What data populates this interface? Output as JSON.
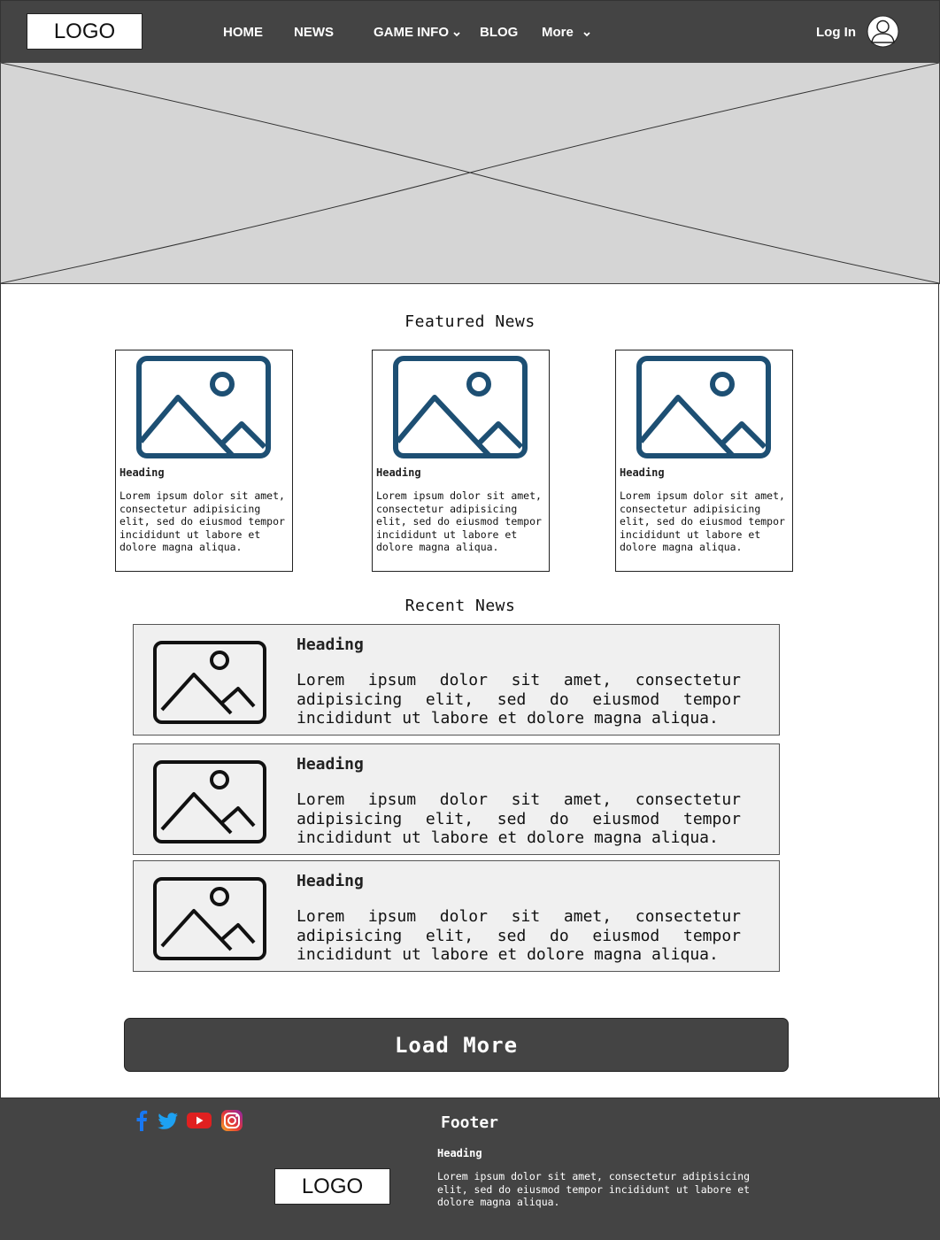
{
  "header": {
    "logo": "LOGO",
    "nav": [
      {
        "label": "HOME",
        "has_dropdown": false
      },
      {
        "label": "NEWS",
        "has_dropdown": false
      },
      {
        "label": "GAME INFO",
        "has_dropdown": true
      },
      {
        "label": "BLOG",
        "has_dropdown": false
      },
      {
        "label": "More",
        "has_dropdown": true
      }
    ],
    "login": "Log In",
    "avatar_icon": "user-avatar-icon"
  },
  "hero": {
    "icon": "image-placeholder-cross"
  },
  "featured": {
    "title": "Featured News",
    "cards": [
      {
        "heading": "Heading",
        "text": "Lorem ipsum dolor sit amet, consectetur adipisicing elit, sed do eiusmod tempor incididunt ut labore et dolore magna aliqua.",
        "icon": "image-icon"
      },
      {
        "heading": "Heading",
        "text": "Lorem ipsum dolor sit amet, consectetur adipisicing elit, sed do eiusmod tempor incididunt ut labore et dolore magna aliqua.",
        "icon": "image-icon"
      },
      {
        "heading": "Heading",
        "text": "Lorem ipsum dolor sit amet, consectetur adipisicing elit, sed do eiusmod tempor incididunt ut labore et dolore magna aliqua.",
        "icon": "image-icon"
      }
    ]
  },
  "recent": {
    "title": "Recent News",
    "items": [
      {
        "heading": "Heading",
        "text": "Lorem ipsum dolor sit amet, consectetur adipisicing elit, sed do eiusmod tempor incididunt ut labore et dolore magna aliqua.",
        "icon": "image-icon"
      },
      {
        "heading": "Heading",
        "text": "Lorem ipsum dolor sit amet, consectetur adipisicing elit, sed do eiusmod tempor incididunt ut labore et dolore magna aliqua.",
        "icon": "image-icon"
      },
      {
        "heading": "Heading",
        "text": "Lorem ipsum dolor sit amet, consectetur adipisicing elit, sed do eiusmod tempor incididunt ut labore et dolore magna aliqua.",
        "icon": "image-icon"
      }
    ]
  },
  "load_more": "Load More",
  "footer": {
    "title": "Footer",
    "heading": "Heading",
    "text": "Lorem ipsum dolor sit amet, consectetur adipisicing elit, sed do eiusmod tempor incididunt ut labore et dolore magna aliqua.",
    "logo": "LOGO",
    "social": [
      "facebook-icon",
      "twitter-icon",
      "youtube-icon",
      "instagram-icon"
    ]
  },
  "colors": {
    "header_bg": "#444444",
    "hero_bg": "#d5d5d5",
    "card_icon": "#1d4f73",
    "row_bg": "#f0f0f0",
    "facebook": "#1877f2",
    "twitter": "#1da1f2",
    "youtube": "#e02020"
  }
}
